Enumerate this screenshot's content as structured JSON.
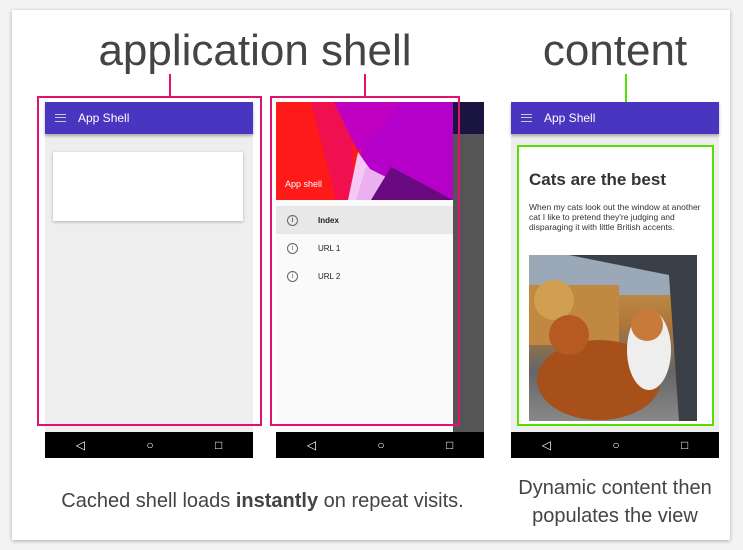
{
  "headings": {
    "shell": "application shell",
    "content": "content"
  },
  "phone1": {
    "title": "App Shell"
  },
  "phone2": {
    "drawer_title": "App shell",
    "items": [
      {
        "label": "Index",
        "icon": "info-icon"
      },
      {
        "label": "URL 1",
        "icon": "info-icon"
      },
      {
        "label": "URL 2",
        "icon": "info-icon"
      }
    ]
  },
  "phone3": {
    "title": "App Shell",
    "article_title": "Cats are the best",
    "article_text": "When my cats look out the window at another cat I like to pretend they're judging and disparaging it with little British accents."
  },
  "nav": {
    "back": "◁",
    "home": "○",
    "recent": "□"
  },
  "captions": {
    "left_pre": "Cached shell loads ",
    "left_bold": "instantly",
    "left_post": " on repeat visits.",
    "right_line1": "Dynamic content then",
    "right_line2": "populates the view"
  },
  "colors": {
    "appbar": "#4a35c0",
    "shell_outline": "#e0126f",
    "content_outline": "#55e000"
  }
}
